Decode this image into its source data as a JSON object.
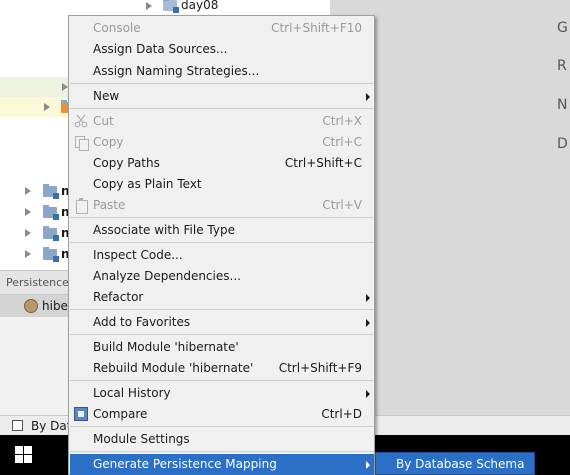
{
  "background": {
    "tree": {
      "day08": "day08",
      "module_prefix": "n"
    },
    "panel_tab": "Persistence",
    "hibernate_label": "hibe",
    "statusbar_label": "By Dat",
    "right_panel_letters": [
      "G",
      "R",
      "N",
      "D"
    ]
  },
  "context_menu": {
    "console": {
      "label": "Console",
      "shortcut": "Ctrl+Shift+F10"
    },
    "assign_data_sources": {
      "label": "Assign Data Sources..."
    },
    "assign_naming_strategies": {
      "label": "Assign Naming Strategies..."
    },
    "new": {
      "label": "New"
    },
    "cut": {
      "label": "Cut",
      "shortcut": "Ctrl+X"
    },
    "copy": {
      "label": "Copy",
      "shortcut": "Ctrl+C"
    },
    "copy_paths": {
      "label": "Copy Paths",
      "shortcut": "Ctrl+Shift+C"
    },
    "copy_plain_text": {
      "label": "Copy as Plain Text"
    },
    "paste": {
      "label": "Paste",
      "shortcut": "Ctrl+V"
    },
    "associate_file_type": {
      "label": "Associate with File Type"
    },
    "inspect_code": {
      "label": "Inspect Code..."
    },
    "analyze_dependencies": {
      "label": "Analyze Dependencies..."
    },
    "refactor": {
      "label": "Refactor"
    },
    "add_to_favorites": {
      "label": "Add to Favorites"
    },
    "build_module": {
      "label": "Build Module 'hibernate'"
    },
    "rebuild_module": {
      "label": "Rebuild Module 'hibernate'",
      "shortcut": "Ctrl+Shift+F9"
    },
    "local_history": {
      "label": "Local History"
    },
    "compare": {
      "label": "Compare",
      "shortcut": "Ctrl+D"
    },
    "module_settings": {
      "label": "Module Settings"
    },
    "generate_persistence_mapping": {
      "label": "Generate Persistence Mapping"
    }
  },
  "submenu": {
    "by_database_schema": {
      "label": "By Database Schema"
    }
  },
  "colors": {
    "menu_background": "#f0f0f0",
    "highlight": "#2b6fc6",
    "disabled_text": "#9a9a9a"
  }
}
